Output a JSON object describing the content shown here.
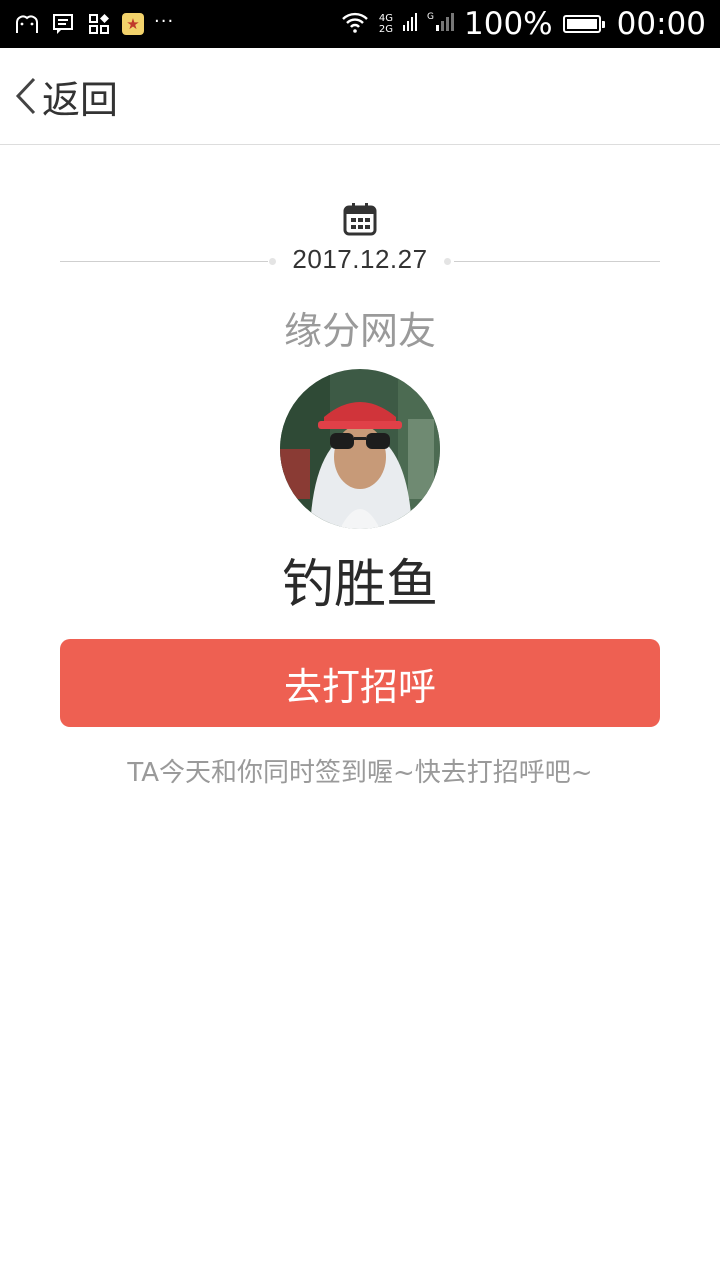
{
  "status_bar": {
    "left_icons": [
      "ghost-icon",
      "message-icon",
      "apps-icon",
      "star-app-icon"
    ],
    "more": "···",
    "network_top": "4G",
    "network_bottom": "2G",
    "network_g": "G",
    "battery_percent": "100%",
    "time": "00:00"
  },
  "nav": {
    "back_label": "返回"
  },
  "content": {
    "date": "2017.12.27",
    "subtitle": "缘分网友",
    "username": "钓胜鱼",
    "greet_button": "去打招呼",
    "hint": "TA今天和你同时签到喔~快去打招呼吧~"
  },
  "colors": {
    "accent": "#ee6052",
    "status_bar_bg": "#000000"
  }
}
